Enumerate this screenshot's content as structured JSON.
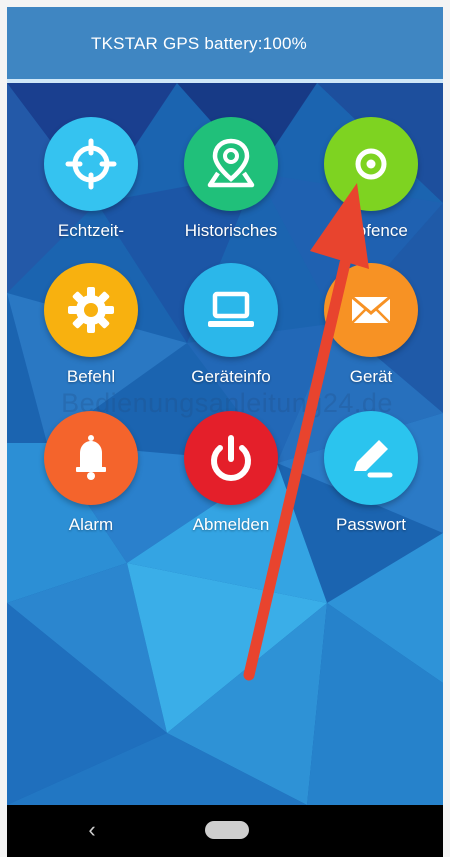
{
  "header": {
    "title": "TKSTAR GPS battery:100%"
  },
  "tiles": [
    {
      "label": "Echtzeit-",
      "icon": "crosshair-icon",
      "color": "#35c3f0"
    },
    {
      "label": "Historisches",
      "icon": "map-pin-icon",
      "color": "#20c07a"
    },
    {
      "label": "Geofence",
      "icon": "target-icon",
      "color": "#7ed321"
    },
    {
      "label": "Befehl",
      "icon": "gear-icon",
      "color": "#f8b10f"
    },
    {
      "label": "Geräteinfo",
      "icon": "laptop-icon",
      "color": "#2bb7ea"
    },
    {
      "label": "Gerät",
      "icon": "envelope-icon",
      "color": "#f79224"
    },
    {
      "label": "Alarm",
      "icon": "bell-icon",
      "color": "#f4642c"
    },
    {
      "label": "Abmelden",
      "icon": "power-icon",
      "color": "#e41f2a"
    },
    {
      "label": "Passwort",
      "icon": "pencil-icon",
      "color": "#2bc4ee"
    }
  ],
  "watermark": "Bedienungsanleitung24.de",
  "annotation_color": "#e8442e",
  "navigation": {
    "back_icon": "chevron-left-icon",
    "home_icon": "home-pill-icon"
  }
}
